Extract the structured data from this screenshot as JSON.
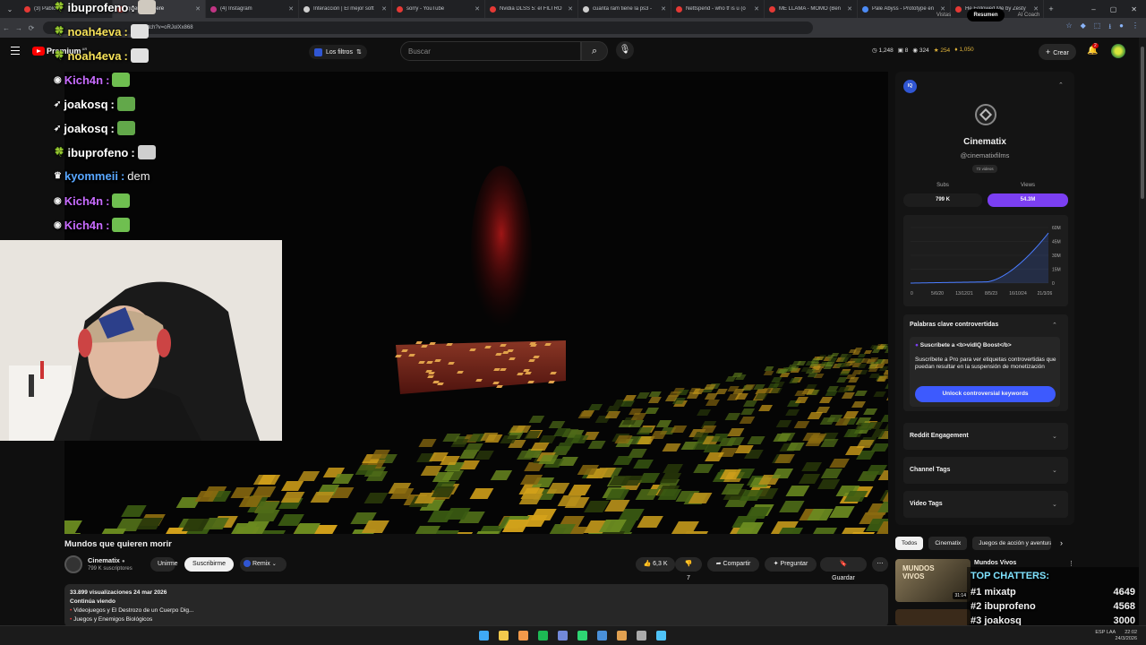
{
  "browser": {
    "tabs": [
      {
        "title": "(3) Pablo",
        "color": "#e53935"
      },
      {
        "title": "quien se quiere",
        "color": "#e53935",
        "active": true
      },
      {
        "title": "(4) Instagram",
        "color": "#c13584"
      },
      {
        "title": "Interacción | El mejor soft",
        "color": "#cfcfcf"
      },
      {
        "title": "sorry - YouTube",
        "color": "#e53935"
      },
      {
        "title": "Nvidia DLSS 5: el FILTRO",
        "color": "#e53935"
      },
      {
        "title": "cuanta ram tiene la ps3 -",
        "color": "#cfcfcf"
      },
      {
        "title": "Nettspend - who tf is u (o",
        "color": "#e53935"
      },
      {
        "title": "ME LLAMA - MOMO (Ben",
        "color": "#e53935"
      },
      {
        "title": "Pale Abyss - Prototype en",
        "color": "#4c8bf5"
      },
      {
        "title": "He Followed Me by Zesty",
        "color": "#e53935"
      }
    ],
    "new_tab": "+",
    "address_text": "/watch?v=oRJolXx868",
    "window_controls": [
      "⌄",
      "–",
      "▢",
      "✕"
    ]
  },
  "youtube": {
    "brand": "Premium",
    "brand_suffix": "AR",
    "filters_label": "Los filtros",
    "search_placeholder": "Buscar",
    "stats": [
      "1,248",
      "8",
      "324",
      "254",
      "1,050"
    ],
    "create_label": "Crear",
    "notification_count": "2"
  },
  "video": {
    "title": "Mundos que quieren morir",
    "channel": "Cinematix",
    "subscribers": "799 K suscriptores",
    "join_label": "Unirme",
    "subscribe_label": "Suscribirme",
    "remix_label": "Remix",
    "likes": "6,3 K",
    "dislikes": "7",
    "share_label": "Compartir",
    "ask_label": "Preguntar",
    "save_label": "Guardar",
    "more_label": "⋯",
    "views_date": "33.899 visualizaciones  24 mar 2026",
    "continue_label": "Continúa viendo",
    "continue_items": [
      "Videojuegos y El Destrozo de un Cuerpo Dig...",
      "Juegos y Enemigos Biológicos"
    ]
  },
  "vidiq": {
    "badge": "IQ",
    "tabs": [
      "Vistas",
      "Resumen",
      "AI Coach"
    ],
    "active_tab": "Resumen",
    "channel_name": "Cinematix",
    "handle": "@cinematixfilms",
    "video_count": "72 videos",
    "subs_label": "Subs",
    "subs_value": "799 K",
    "views_label": "Views",
    "views_value": "54.3M",
    "chart_y_labels": [
      "60M",
      "45M",
      "30M",
      "15M",
      "0"
    ],
    "chart_x_labels": [
      "0",
      "5/6/20",
      "13/12/21",
      "8/5/23",
      "16/10/24",
      "21/3/26"
    ],
    "controversial_title": "Palabras clave controvertidas",
    "subscribe_pro": "Suscríbete a <b>vidIQ Boost</b>",
    "pro_description": "Suscríbete a Pro para ver etiquetas controvertidas que puedan resultar en la suspensión de monetización",
    "unlock_button": "Unlock controversial keywords",
    "sections": [
      "Reddit Engagement",
      "Channel Tags",
      "Video Tags"
    ]
  },
  "chips": [
    "Todos",
    "Cinematix",
    "Juegos de acción y aventura"
  ],
  "recommendation": {
    "title": "Mundos Vivos",
    "badge": "31:14",
    "thumb_text": "MUNDOS VIVOS"
  },
  "chat": [
    {
      "user": "ibuprofeno",
      "color": "#ffffff",
      "badge": "🍀",
      "msg": "",
      "emote": "#cfc9bf"
    },
    {
      "user": "noah4eva",
      "color": "#f6e25a",
      "badge": "🍀",
      "msg": "",
      "emote": "#e0e0e0"
    },
    {
      "user": "noah4eva",
      "color": "#f6e25a",
      "badge": "🍀",
      "msg": "",
      "emote": "#e0e0e0"
    },
    {
      "user": "Kich4n",
      "color": "#c86cff",
      "badge": "◉",
      "msg": "",
      "emote": "#6fbf50"
    },
    {
      "user": "joakosq",
      "color": "#ffffff",
      "badge": "➶",
      "msg": "",
      "emote": "#62a84a"
    },
    {
      "user": "joakosq",
      "color": "#ffffff",
      "badge": "➶",
      "msg": "",
      "emote": "#62a84a"
    },
    {
      "user": "ibuprofeno",
      "color": "#ffffff",
      "badge": "🍀",
      "msg": "",
      "emote": "#cfcfcf"
    },
    {
      "user": "kyommeii",
      "color": "#59a7ff",
      "badge": "♛",
      "msg": "dem",
      "emote": ""
    },
    {
      "user": "Kich4n",
      "color": "#c86cff",
      "badge": "◉",
      "msg": "",
      "emote": "#6fbf50"
    },
    {
      "user": "Kich4n",
      "color": "#c86cff",
      "badge": "◉",
      "msg": "",
      "emote": "#6fbf50"
    }
  ],
  "top_chatters": {
    "title": "TOP CHATTERS:",
    "rows": [
      {
        "rank": "#1",
        "name": "mixatp",
        "count": "4649"
      },
      {
        "rank": "#2",
        "name": "ibuprofeno",
        "count": "4568"
      },
      {
        "rank": "#3",
        "name": "joakosq",
        "count": "3000"
      }
    ]
  },
  "taskbar": {
    "lang": "ESP LAA",
    "time": "22:02",
    "date": "24/3/2026",
    "icons": [
      {
        "name": "windows",
        "color": "#3fa9f5"
      },
      {
        "name": "explorer",
        "color": "#f2c94c"
      },
      {
        "name": "chrome",
        "color": "#f2994a"
      },
      {
        "name": "spotify",
        "color": "#1db954"
      },
      {
        "name": "discord",
        "color": "#7289da"
      },
      {
        "name": "obs",
        "color": "#2ed573"
      },
      {
        "name": "steam",
        "color": "#4a90d9"
      },
      {
        "name": "app",
        "color": "#e0a050"
      },
      {
        "name": "settings",
        "color": "#aaaaaa"
      },
      {
        "name": "store",
        "color": "#4fc3f7"
      }
    ]
  },
  "colors": {
    "accent": "#7b3ff2",
    "unlock": "#3d5afe",
    "chart_line": "#4a7cff",
    "brand_red": "#ff0000"
  }
}
